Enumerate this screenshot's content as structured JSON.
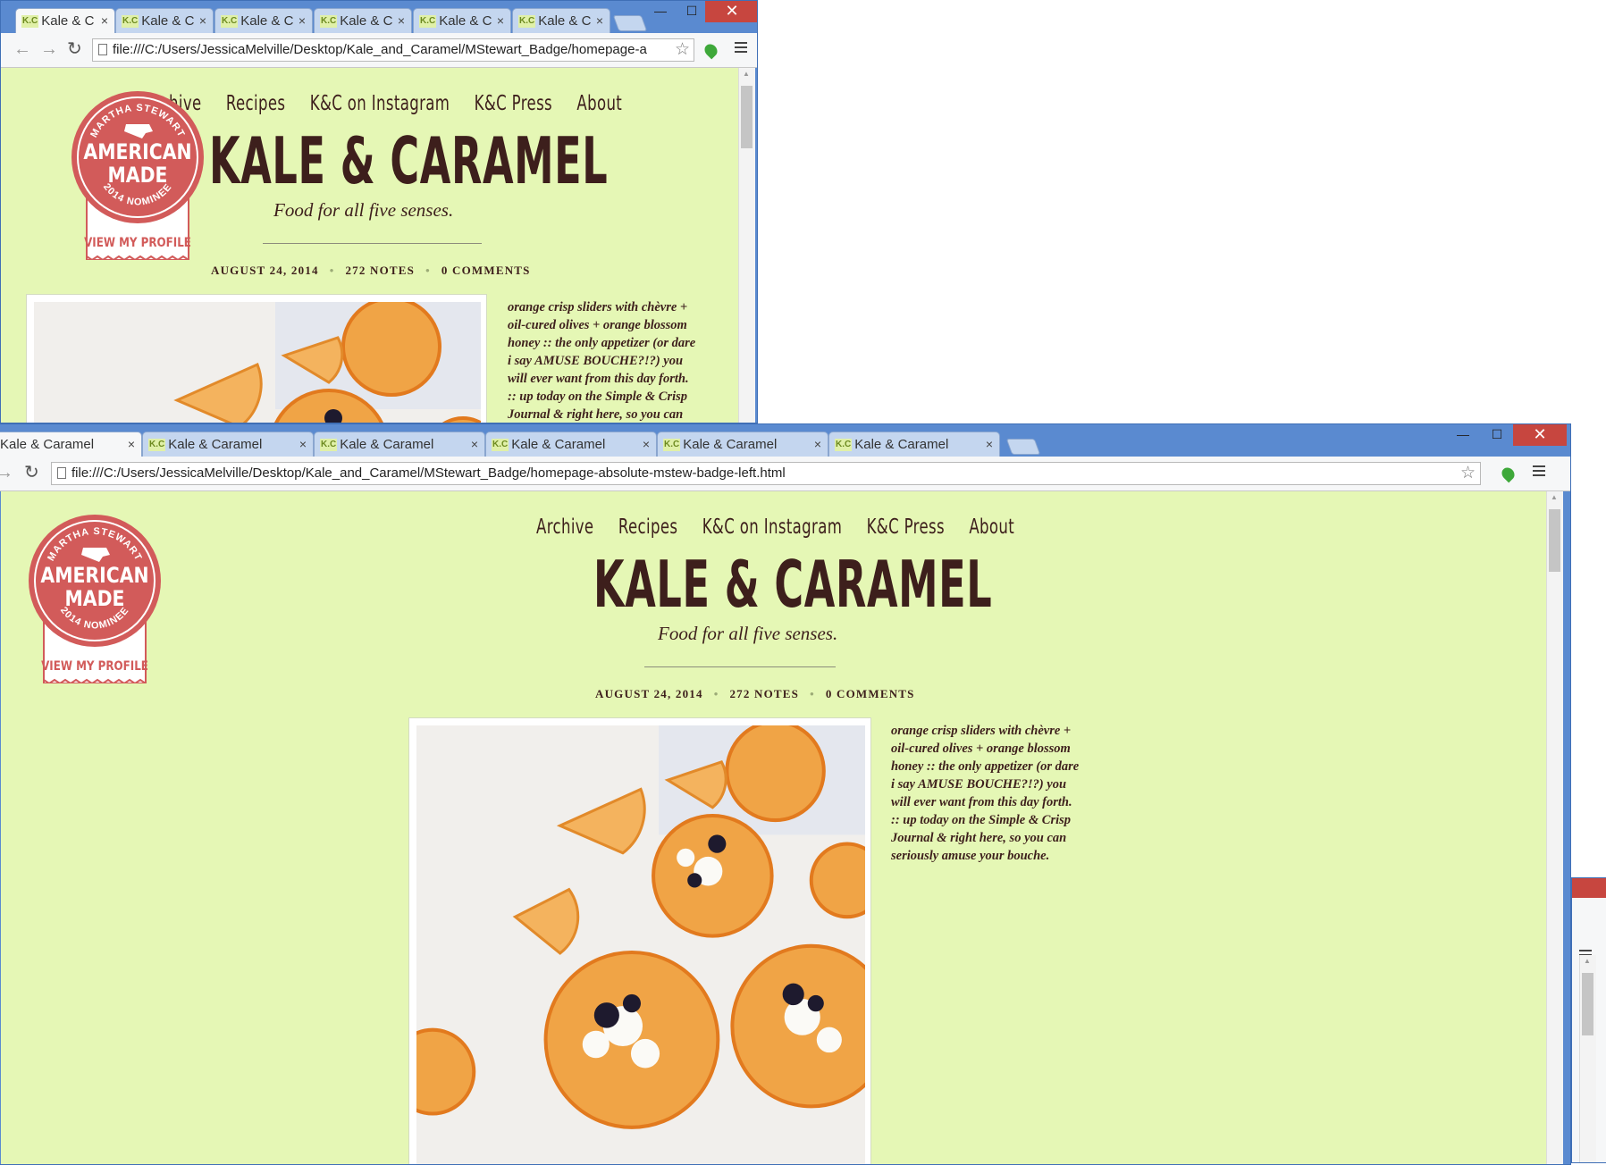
{
  "tabs": {
    "back_window": [
      "Kale & C",
      "Kale & C",
      "Kale & C",
      "Kale & C",
      "Kale & C",
      "Kale & C"
    ],
    "front_window": [
      "Kale & Caramel",
      "Kale & Caramel",
      "Kale & Caramel",
      "Kale & Caramel",
      "Kale & Caramel",
      "Kale & Caramel"
    ],
    "favicon": "K.C",
    "close_glyph": "×"
  },
  "address_bar": {
    "back_url": "file:///C:/Users/JessicaMelville/Desktop/Kale_and_Caramel/MStewart_Badge/homepage-a",
    "front_url": "file:///C:/Users/JessicaMelville/Desktop/Kale_and_Caramel/MStewart_Badge/homepage-absolute-mstew-badge-left.html"
  },
  "window_controls": {
    "minimize": "—",
    "maximize": "☐",
    "close": "✕"
  },
  "nav": {
    "archive": "Archive",
    "archive_partial": "hive",
    "recipes": "Recipes",
    "instagram": "K&C on Instagram",
    "press": "K&C Press",
    "about": "About"
  },
  "site": {
    "title": "KALE & CARAMEL",
    "tagline": "Food for all five senses."
  },
  "post_meta": {
    "date": "AUGUST 24, 2014",
    "notes": "272 NOTES",
    "comments": "0 COMMENTS",
    "separator": "•"
  },
  "post": {
    "caption_full": "orange crisp sliders with chèvre + oil-cured olives + orange blossom honey :: the only appetizer (or dare i say AMUSE BOUCHE?!?) you will ever want from this day forth. :: up today on the Simple & Crisp Journal & right here, so you can seriously amuse your bouche.",
    "lines": [
      "orange crisp sliders with chèvre +",
      "oil-cured olives + orange blossom",
      "honey :: the only appetizer (or dare",
      "i say AMUSE BOUCHE?!?) you",
      "will ever want from this day forth.",
      ":: up today on the Simple & Crisp",
      "Journal & right here, so you can",
      "seriously amuse your bouche."
    ]
  },
  "badge": {
    "arc_top": "MARTHA STEWART",
    "line1": "AMERICAN",
    "line2": "MADE",
    "arc_bottom": "2014 NOMINEE",
    "link": "VIEW MY PROFILE"
  },
  "colors": {
    "page_bg": "#e5f7b5",
    "text": "#3d1f1c",
    "badge_red": "#d25b5a",
    "chrome_frame": "#5a8ad0",
    "close_red": "#c7463f"
  }
}
